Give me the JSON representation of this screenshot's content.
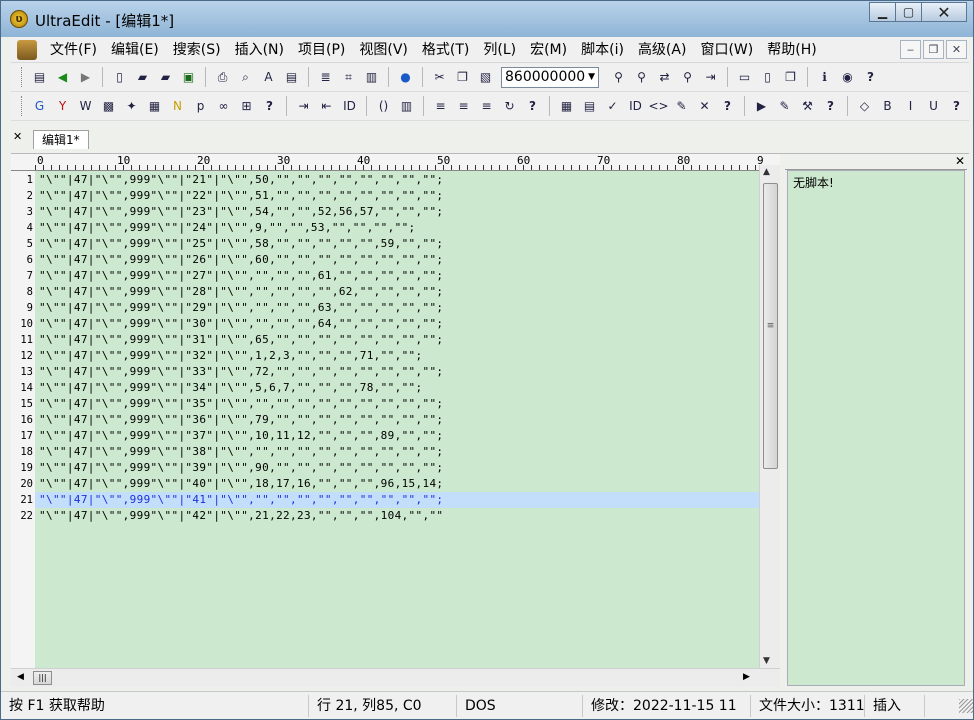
{
  "app": {
    "title": "UltraEdit - [编辑1*]"
  },
  "window_buttons": {
    "minimize": "▁",
    "maximize": "▢",
    "close": "✕"
  },
  "menu": [
    "文件(F)",
    "编辑(E)",
    "搜索(S)",
    "插入(N)",
    "项目(P)",
    "视图(V)",
    "格式(T)",
    "列(L)",
    "宏(M)",
    "脚本(i)",
    "高级(A)",
    "窗口(W)",
    "帮助(H)"
  ],
  "mdi_buttons": {
    "minimize": "‒",
    "restore": "❐",
    "close": "✕"
  },
  "toolbar1": {
    "icons": [
      "open-project-icon",
      "back-icon",
      "forward-icon",
      "new-file-icon",
      "open-file-icon",
      "open-folder-icon",
      "save-icon",
      "print-icon",
      "print-preview-icon",
      "spell-check-icon",
      "document-icon",
      "wrap-icon",
      "hex-icon",
      "column-mode-icon",
      "web-icon",
      "cut-icon",
      "copy-icon",
      "paste-icon"
    ],
    "combo_value": "860000000",
    "icons_after": [
      "find-icon",
      "find-next-icon",
      "replace-icon",
      "find-in-files-icon",
      "goto-icon",
      "split-horizontal-icon",
      "split-vertical-icon",
      "windows-icon",
      "info-icon",
      "help-context-icon"
    ],
    "help": "?"
  },
  "toolbar2": {
    "icons": [
      "google-icon",
      "yahoo-icon",
      "wikipedia-icon",
      "msdn-icon",
      "bulb-icon",
      "wordfile-icon",
      "n-icon",
      "php-icon",
      "chain-icon",
      "windows-logo-icon"
    ],
    "help1": "?",
    "icons_b": [
      "indent-icon",
      "outdent-icon",
      "id-icon",
      "brace-icon",
      "column-icon",
      "format1-icon",
      "format2-icon",
      "format3-icon",
      "reformat-icon"
    ],
    "help2": "?",
    "icons_c": [
      "table-icon",
      "copy-table-icon",
      "validate-icon",
      "id2-icon",
      "tag-icon",
      "color-picker-icon",
      "cancel-icon"
    ],
    "help3": "?",
    "icons_d": [
      "macro-icon",
      "edit-macro-icon",
      "tools-icon"
    ],
    "help4": "?",
    "icons_e": [
      "html-icon",
      "bold-icon",
      "italic-icon",
      "underline-icon"
    ],
    "help5": "?"
  },
  "tab": {
    "label": "编辑1*",
    "close": "✕"
  },
  "ruler": [
    "0",
    "10",
    "20",
    "30",
    "40",
    "50",
    "60",
    "70",
    "80",
    "9"
  ],
  "editor": {
    "active_line": 21,
    "lines": [
      {
        "n": "1",
        "t": "\"\\\"\"|47|\"\\\"\",999\"\\\"\"|\"21\"|\"\\\"\",50,\"\",\"\",\"\",\"\",\"\",\"\",\"\",\"\";"
      },
      {
        "n": "2",
        "t": "\"\\\"\"|47|\"\\\"\",999\"\\\"\"|\"22\"|\"\\\"\",51,\"\",\"\",\"\",\"\",\"\",\"\",\"\",\"\";"
      },
      {
        "n": "3",
        "t": "\"\\\"\"|47|\"\\\"\",999\"\\\"\"|\"23\"|\"\\\"\",54,\"\",\"\",52,56,57,\"\",\"\",\"\";"
      },
      {
        "n": "4",
        "t": "\"\\\"\"|47|\"\\\"\",999\"\\\"\"|\"24\"|\"\\\"\",9,\"\",\"\",53,\"\",\"\",\"\",\"\";"
      },
      {
        "n": "5",
        "t": "\"\\\"\"|47|\"\\\"\",999\"\\\"\"|\"25\"|\"\\\"\",58,\"\",\"\",\"\",\"\",\"\",59,\"\",\"\";"
      },
      {
        "n": "6",
        "t": "\"\\\"\"|47|\"\\\"\",999\"\\\"\"|\"26\"|\"\\\"\",60,\"\",\"\",\"\",\"\",\"\",\"\",\"\",\"\";"
      },
      {
        "n": "7",
        "t": "\"\\\"\"|47|\"\\\"\",999\"\\\"\"|\"27\"|\"\\\"\",\"\",\"\",\"\",61,\"\",\"\",\"\",\"\",\"\";"
      },
      {
        "n": "8",
        "t": "\"\\\"\"|47|\"\\\"\",999\"\\\"\"|\"28\"|\"\\\"\",\"\",\"\",\"\",\"\",62,\"\",\"\",\"\",\"\";"
      },
      {
        "n": "9",
        "t": "\"\\\"\"|47|\"\\\"\",999\"\\\"\"|\"29\"|\"\\\"\",\"\",\"\",\"\",63,\"\",\"\",\"\",\"\",\"\";"
      },
      {
        "n": "10",
        "t": "\"\\\"\"|47|\"\\\"\",999\"\\\"\"|\"30\"|\"\\\"\",\"\",\"\",\"\",64,\"\",\"\",\"\",\"\",\"\";"
      },
      {
        "n": "11",
        "t": "\"\\\"\"|47|\"\\\"\",999\"\\\"\"|\"31\"|\"\\\"\",65,\"\",\"\",\"\",\"\",\"\",\"\",\"\",\"\";"
      },
      {
        "n": "12",
        "t": "\"\\\"\"|47|\"\\\"\",999\"\\\"\"|\"32\"|\"\\\"\",1,2,3,\"\",\"\",\"\",71,\"\",\"\";"
      },
      {
        "n": "13",
        "t": "\"\\\"\"|47|\"\\\"\",999\"\\\"\"|\"33\"|\"\\\"\",72,\"\",\"\",\"\",\"\",\"\",\"\",\"\",\"\";"
      },
      {
        "n": "14",
        "t": "\"\\\"\"|47|\"\\\"\",999\"\\\"\"|\"34\"|\"\\\"\",5,6,7,\"\",\"\",\"\",78,\"\",\"\";"
      },
      {
        "n": "15",
        "t": "\"\\\"\"|47|\"\\\"\",999\"\\\"\"|\"35\"|\"\\\"\",\"\",\"\",\"\",\"\",\"\",\"\",\"\",\"\",\"\";"
      },
      {
        "n": "16",
        "t": "\"\\\"\"|47|\"\\\"\",999\"\\\"\"|\"36\"|\"\\\"\",79,\"\",\"\",\"\",\"\",\"\",\"\",\"\",\"\";"
      },
      {
        "n": "17",
        "t": "\"\\\"\"|47|\"\\\"\",999\"\\\"\"|\"37\"|\"\\\"\",10,11,12,\"\",\"\",\"\",89,\"\",\"\";"
      },
      {
        "n": "18",
        "t": "\"\\\"\"|47|\"\\\"\",999\"\\\"\"|\"38\"|\"\\\"\",\"\",\"\",\"\",\"\",\"\",\"\",\"\",\"\",\"\";"
      },
      {
        "n": "19",
        "t": "\"\\\"\"|47|\"\\\"\",999\"\\\"\"|\"39\"|\"\\\"\",90,\"\",\"\",\"\",\"\",\"\",\"\",\"\",\"\";"
      },
      {
        "n": "20",
        "t": "\"\\\"\"|47|\"\\\"\",999\"\\\"\"|\"40\"|\"\\\"\",18,17,16,\"\",\"\",\"\",96,15,14;"
      },
      {
        "n": "21",
        "t": "\"\\\"\"|47|\"\\\"\",999\"\\\"\"|\"41\"|\"\\\"\",\"\",\"\",\"\",\"\",\"\",\"\",\"\",\"\",\"\";"
      },
      {
        "n": "22",
        "t": "\"\\\"\"|47|\"\\\"\",999\"\\\"\"|\"42\"|\"\\\"\",21,22,23,\"\",\"\",\"\",104,\"\",\"\""
      }
    ]
  },
  "script_panel": {
    "message": "无脚本!",
    "close": "✕"
  },
  "status": {
    "help": "按 F1 获取帮助",
    "position": "行 21, 列85, C0",
    "format": "DOS",
    "modified": "修改：2022-11-15 11",
    "filesize": "文件大小：1311",
    "mode": "插入"
  },
  "colors": {
    "editor_bg": "#cce8cf",
    "active_line_bg": "#c3defb",
    "active_text": "#1a30d8"
  }
}
